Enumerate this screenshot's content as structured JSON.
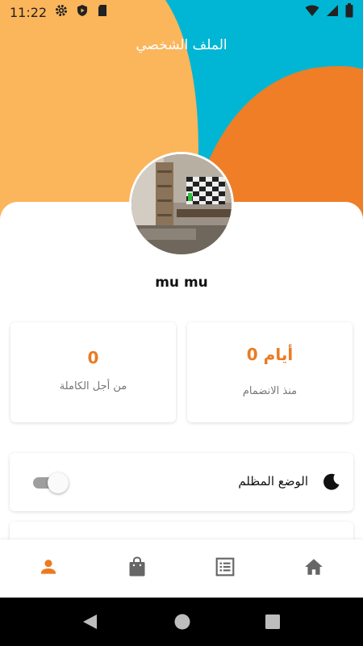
{
  "status_bar": {
    "time": "11:22",
    "left_icons": [
      "gear-icon",
      "shield-play-icon",
      "sd-card-icon"
    ],
    "right_icons": [
      "wifi-icon",
      "signal-icon",
      "battery-icon"
    ]
  },
  "header": {
    "title": "الملف الشخصي"
  },
  "colors": {
    "accent": "#ea7b22",
    "hero_yellow": "#fbb55b",
    "hero_cyan": "#00b6d4",
    "hero_orange": "#ef7e27"
  },
  "profile": {
    "username": "mu mu"
  },
  "stats": [
    {
      "value": "0 أيام",
      "label": "منذ الانضمام"
    },
    {
      "value": "0",
      "label": "من أجل الكاملة"
    }
  ],
  "settings": {
    "dark_mode_label": "الوضع المظلم",
    "dark_mode_enabled": false
  },
  "bottom_nav": {
    "items": [
      {
        "icon": "person-icon",
        "active": true
      },
      {
        "icon": "shopping-bag-icon",
        "active": false
      },
      {
        "icon": "list-icon",
        "active": false
      },
      {
        "icon": "home-icon",
        "active": false
      }
    ]
  },
  "system_nav": [
    "back-icon",
    "home-circle-icon",
    "recents-icon"
  ]
}
